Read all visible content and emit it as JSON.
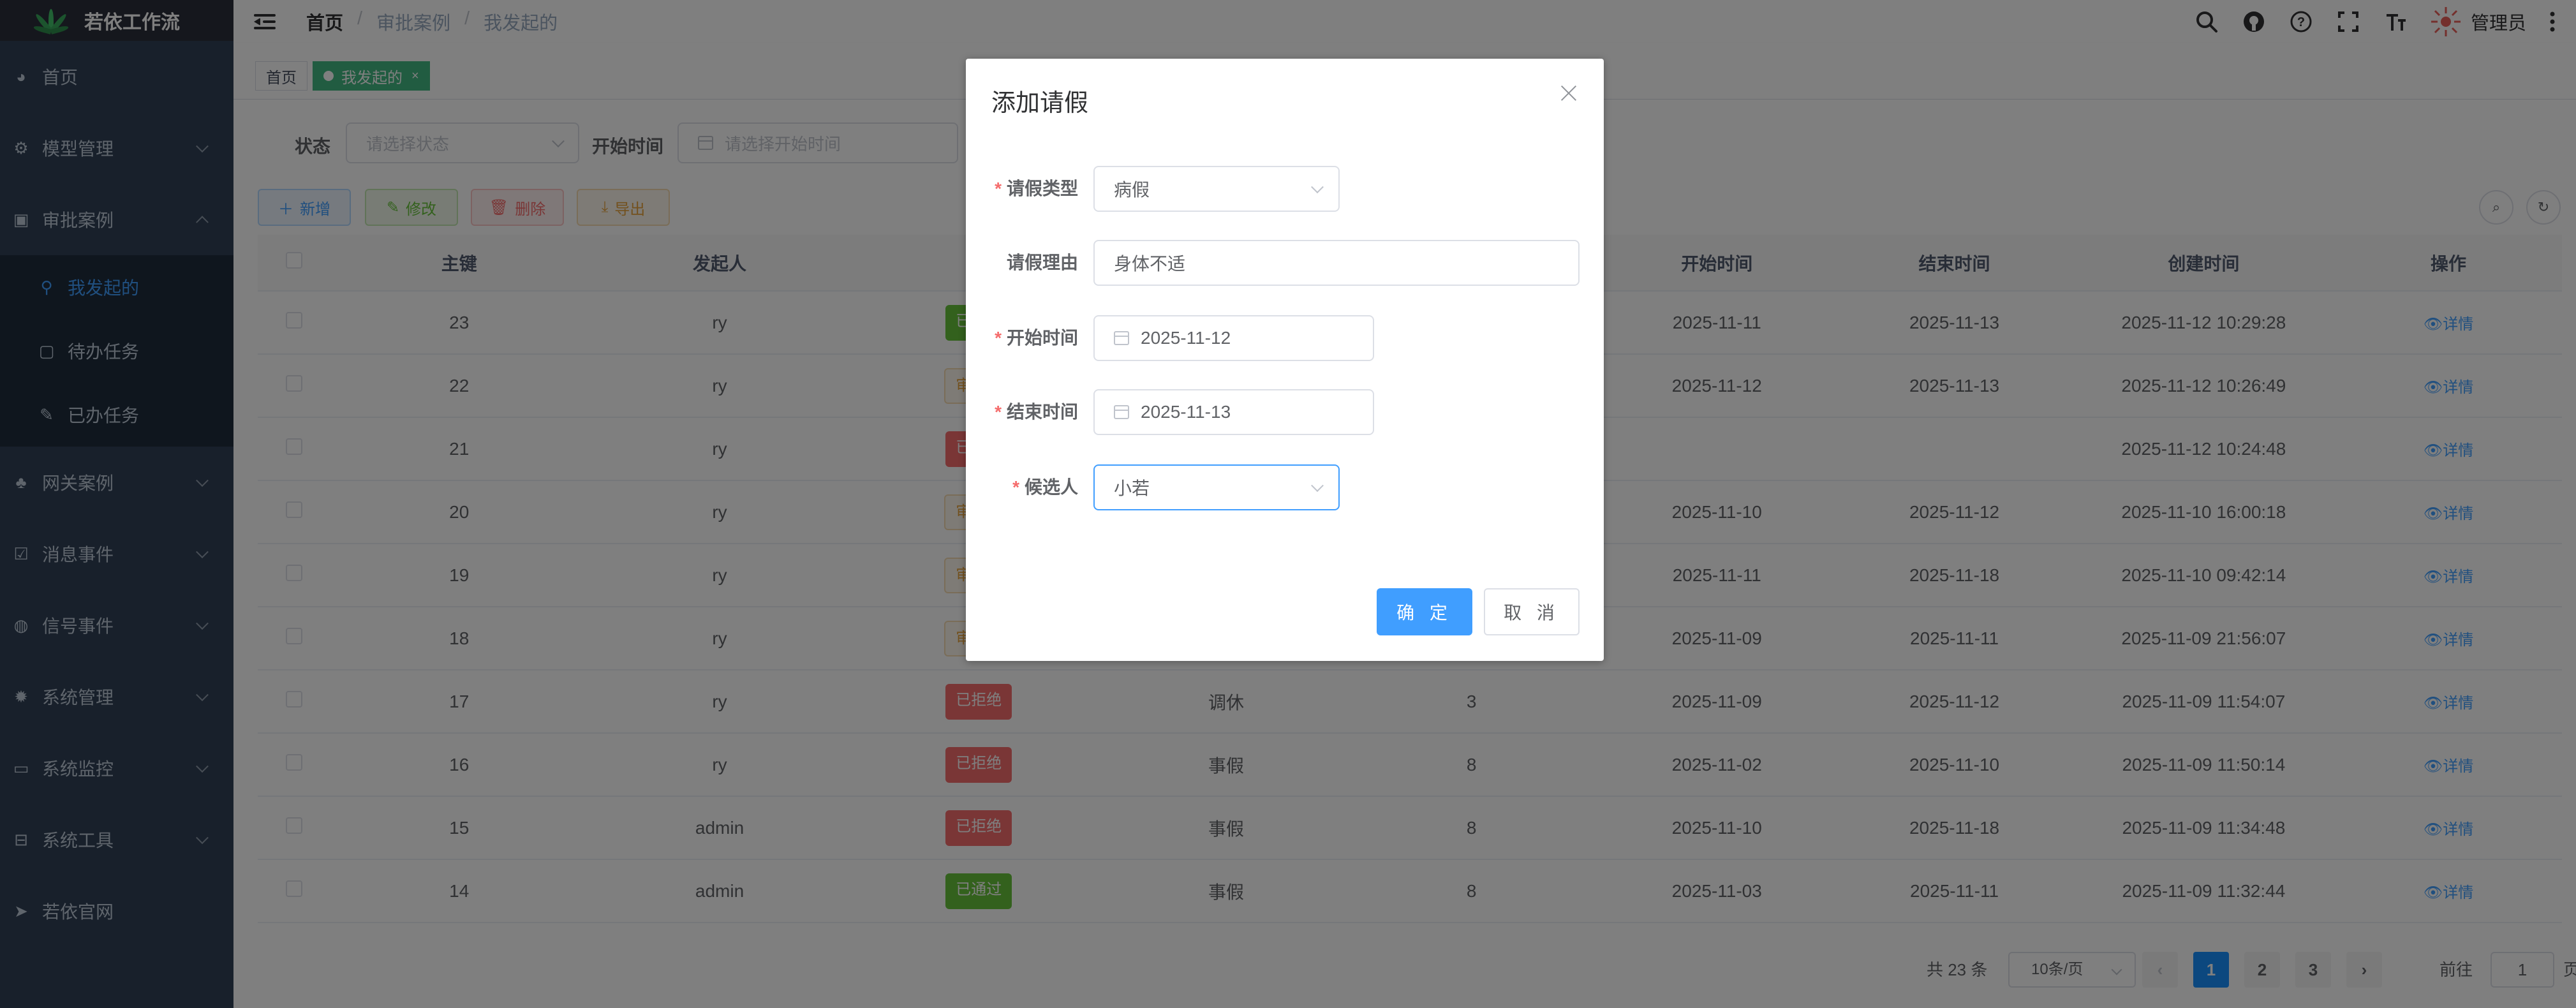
{
  "app": {
    "title": "若依工作流"
  },
  "sidebar": {
    "items": [
      {
        "label": "首页",
        "icon": "dashboard-icon"
      },
      {
        "label": "模型管理",
        "icon": "model-icon"
      },
      {
        "label": "审批案例",
        "icon": "approval-icon"
      },
      {
        "label": "网关案例",
        "icon": "gateway-icon"
      },
      {
        "label": "消息事件",
        "icon": "message-icon"
      },
      {
        "label": "信号事件",
        "icon": "signal-icon"
      },
      {
        "label": "系统管理",
        "icon": "gear-icon"
      },
      {
        "label": "系统监控",
        "icon": "monitor-icon"
      },
      {
        "label": "系统工具",
        "icon": "toolbox-icon"
      },
      {
        "label": "若依官网",
        "icon": "send-icon"
      }
    ],
    "submenu": [
      {
        "label": "我发起的"
      },
      {
        "label": "待办任务"
      },
      {
        "label": "已办任务"
      }
    ]
  },
  "header": {
    "breadcrumb": [
      "首页",
      "审批案例",
      "我发起的"
    ],
    "user_name": "管理员"
  },
  "tags": [
    {
      "label": "首页"
    },
    {
      "label": "我发起的"
    }
  ],
  "filters": {
    "status_label": "状态",
    "status_placeholder": "请选择状态",
    "start_label": "开始时间",
    "start_placeholder": "请选择开始时间"
  },
  "toolbar": {
    "add": "新增",
    "edit": "修改",
    "delete": "删除",
    "export": "导出"
  },
  "table": {
    "headers": [
      "主键",
      "发起人",
      "状",
      "",
      "",
      "开始时间",
      "结束时间",
      "创建时间",
      "操作"
    ],
    "rows": [
      {
        "id": "23",
        "user": "ry",
        "status": "已通过",
        "status_type": "green",
        "type": "",
        "days": "",
        "start": "2025-11-11",
        "end": "2025-11-13",
        "created": "2025-11-12 10:29:28"
      },
      {
        "id": "22",
        "user": "ry",
        "status": "审批中",
        "status_type": "orange",
        "type": "",
        "days": "",
        "start": "2025-11-12",
        "end": "2025-11-13",
        "created": "2025-11-12 10:26:49"
      },
      {
        "id": "21",
        "user": "ry",
        "status": "已拒绝",
        "status_type": "red",
        "type": "",
        "days": "",
        "start": "",
        "end": "",
        "created": "2025-11-12 10:24:48"
      },
      {
        "id": "20",
        "user": "ry",
        "status": "审批中",
        "status_type": "orange",
        "type": "",
        "days": "",
        "start": "2025-11-10",
        "end": "2025-11-12",
        "created": "2025-11-10 16:00:18"
      },
      {
        "id": "19",
        "user": "ry",
        "status": "审批中",
        "status_type": "orange",
        "type": "",
        "days": "",
        "start": "2025-11-11",
        "end": "2025-11-18",
        "created": "2025-11-10 09:42:14"
      },
      {
        "id": "18",
        "user": "ry",
        "status": "审批中",
        "status_type": "orange",
        "type": "",
        "days": "",
        "start": "2025-11-09",
        "end": "2025-11-11",
        "created": "2025-11-09 21:56:07"
      },
      {
        "id": "17",
        "user": "ry",
        "status": "已拒绝",
        "status_type": "red",
        "type": "调休",
        "days": "3",
        "start": "2025-11-09",
        "end": "2025-11-12",
        "created": "2025-11-09 11:54:07"
      },
      {
        "id": "16",
        "user": "ry",
        "status": "已拒绝",
        "status_type": "red",
        "type": "事假",
        "days": "8",
        "start": "2025-11-02",
        "end": "2025-11-10",
        "created": "2025-11-09 11:50:14"
      },
      {
        "id": "15",
        "user": "admin",
        "status": "已拒绝",
        "status_type": "red",
        "type": "事假",
        "days": "8",
        "start": "2025-11-10",
        "end": "2025-11-18",
        "created": "2025-11-09 11:34:48"
      },
      {
        "id": "14",
        "user": "admin",
        "status": "已通过",
        "status_type": "green",
        "type": "事假",
        "days": "8",
        "start": "2025-11-03",
        "end": "2025-11-11",
        "created": "2025-11-09 11:32:44"
      }
    ],
    "detail_label": "详情"
  },
  "pagination": {
    "total": "共 23 条",
    "page_size": "10条/页",
    "pages": [
      "1",
      "2",
      "3"
    ],
    "goto_label": "前往",
    "goto_value": "1",
    "page_suffix": "页"
  },
  "dialog": {
    "title": "添加请假",
    "fields": {
      "type_label": "请假类型",
      "type_value": "病假",
      "reason_label": "请假理由",
      "reason_value": "身体不适",
      "start_label": "开始时间",
      "start_value": "2025-11-12",
      "end_label": "结束时间",
      "end_value": "2025-11-13",
      "candidate_label": "候选人",
      "candidate_value": "小若"
    },
    "confirm": "确 定",
    "cancel": "取 消"
  },
  "colors": {
    "sidebar_bg": "#304156",
    "primary": "#409eff",
    "success": "#67c23a",
    "danger": "#f56c6c",
    "warning": "#e6a23c"
  }
}
